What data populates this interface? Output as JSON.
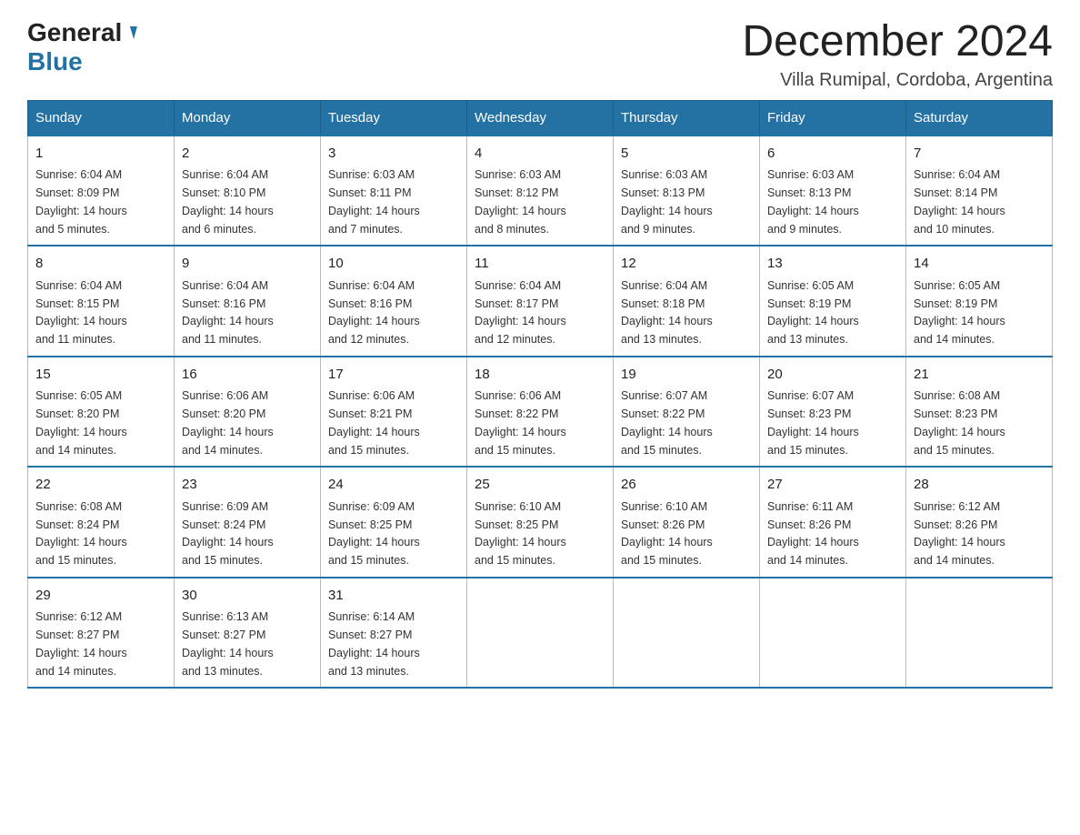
{
  "header": {
    "logo_general": "General",
    "logo_blue": "Blue",
    "main_title": "December 2024",
    "subtitle": "Villa Rumipal, Cordoba, Argentina"
  },
  "days_of_week": [
    "Sunday",
    "Monday",
    "Tuesday",
    "Wednesday",
    "Thursday",
    "Friday",
    "Saturday"
  ],
  "weeks": [
    [
      {
        "day": "1",
        "sunrise": "6:04 AM",
        "sunset": "8:09 PM",
        "daylight": "14 hours and 5 minutes."
      },
      {
        "day": "2",
        "sunrise": "6:04 AM",
        "sunset": "8:10 PM",
        "daylight": "14 hours and 6 minutes."
      },
      {
        "day": "3",
        "sunrise": "6:03 AM",
        "sunset": "8:11 PM",
        "daylight": "14 hours and 7 minutes."
      },
      {
        "day": "4",
        "sunrise": "6:03 AM",
        "sunset": "8:12 PM",
        "daylight": "14 hours and 8 minutes."
      },
      {
        "day": "5",
        "sunrise": "6:03 AM",
        "sunset": "8:13 PM",
        "daylight": "14 hours and 9 minutes."
      },
      {
        "day": "6",
        "sunrise": "6:03 AM",
        "sunset": "8:13 PM",
        "daylight": "14 hours and 9 minutes."
      },
      {
        "day": "7",
        "sunrise": "6:04 AM",
        "sunset": "8:14 PM",
        "daylight": "14 hours and 10 minutes."
      }
    ],
    [
      {
        "day": "8",
        "sunrise": "6:04 AM",
        "sunset": "8:15 PM",
        "daylight": "14 hours and 11 minutes."
      },
      {
        "day": "9",
        "sunrise": "6:04 AM",
        "sunset": "8:16 PM",
        "daylight": "14 hours and 11 minutes."
      },
      {
        "day": "10",
        "sunrise": "6:04 AM",
        "sunset": "8:16 PM",
        "daylight": "14 hours and 12 minutes."
      },
      {
        "day": "11",
        "sunrise": "6:04 AM",
        "sunset": "8:17 PM",
        "daylight": "14 hours and 12 minutes."
      },
      {
        "day": "12",
        "sunrise": "6:04 AM",
        "sunset": "8:18 PM",
        "daylight": "14 hours and 13 minutes."
      },
      {
        "day": "13",
        "sunrise": "6:05 AM",
        "sunset": "8:19 PM",
        "daylight": "14 hours and 13 minutes."
      },
      {
        "day": "14",
        "sunrise": "6:05 AM",
        "sunset": "8:19 PM",
        "daylight": "14 hours and 14 minutes."
      }
    ],
    [
      {
        "day": "15",
        "sunrise": "6:05 AM",
        "sunset": "8:20 PM",
        "daylight": "14 hours and 14 minutes."
      },
      {
        "day": "16",
        "sunrise": "6:06 AM",
        "sunset": "8:20 PM",
        "daylight": "14 hours and 14 minutes."
      },
      {
        "day": "17",
        "sunrise": "6:06 AM",
        "sunset": "8:21 PM",
        "daylight": "14 hours and 15 minutes."
      },
      {
        "day": "18",
        "sunrise": "6:06 AM",
        "sunset": "8:22 PM",
        "daylight": "14 hours and 15 minutes."
      },
      {
        "day": "19",
        "sunrise": "6:07 AM",
        "sunset": "8:22 PM",
        "daylight": "14 hours and 15 minutes."
      },
      {
        "day": "20",
        "sunrise": "6:07 AM",
        "sunset": "8:23 PM",
        "daylight": "14 hours and 15 minutes."
      },
      {
        "day": "21",
        "sunrise": "6:08 AM",
        "sunset": "8:23 PM",
        "daylight": "14 hours and 15 minutes."
      }
    ],
    [
      {
        "day": "22",
        "sunrise": "6:08 AM",
        "sunset": "8:24 PM",
        "daylight": "14 hours and 15 minutes."
      },
      {
        "day": "23",
        "sunrise": "6:09 AM",
        "sunset": "8:24 PM",
        "daylight": "14 hours and 15 minutes."
      },
      {
        "day": "24",
        "sunrise": "6:09 AM",
        "sunset": "8:25 PM",
        "daylight": "14 hours and 15 minutes."
      },
      {
        "day": "25",
        "sunrise": "6:10 AM",
        "sunset": "8:25 PM",
        "daylight": "14 hours and 15 minutes."
      },
      {
        "day": "26",
        "sunrise": "6:10 AM",
        "sunset": "8:26 PM",
        "daylight": "14 hours and 15 minutes."
      },
      {
        "day": "27",
        "sunrise": "6:11 AM",
        "sunset": "8:26 PM",
        "daylight": "14 hours and 14 minutes."
      },
      {
        "day": "28",
        "sunrise": "6:12 AM",
        "sunset": "8:26 PM",
        "daylight": "14 hours and 14 minutes."
      }
    ],
    [
      {
        "day": "29",
        "sunrise": "6:12 AM",
        "sunset": "8:27 PM",
        "daylight": "14 hours and 14 minutes."
      },
      {
        "day": "30",
        "sunrise": "6:13 AM",
        "sunset": "8:27 PM",
        "daylight": "14 hours and 13 minutes."
      },
      {
        "day": "31",
        "sunrise": "6:14 AM",
        "sunset": "8:27 PM",
        "daylight": "14 hours and 13 minutes."
      },
      null,
      null,
      null,
      null
    ]
  ],
  "labels": {
    "sunrise": "Sunrise:",
    "sunset": "Sunset:",
    "daylight": "Daylight:"
  }
}
